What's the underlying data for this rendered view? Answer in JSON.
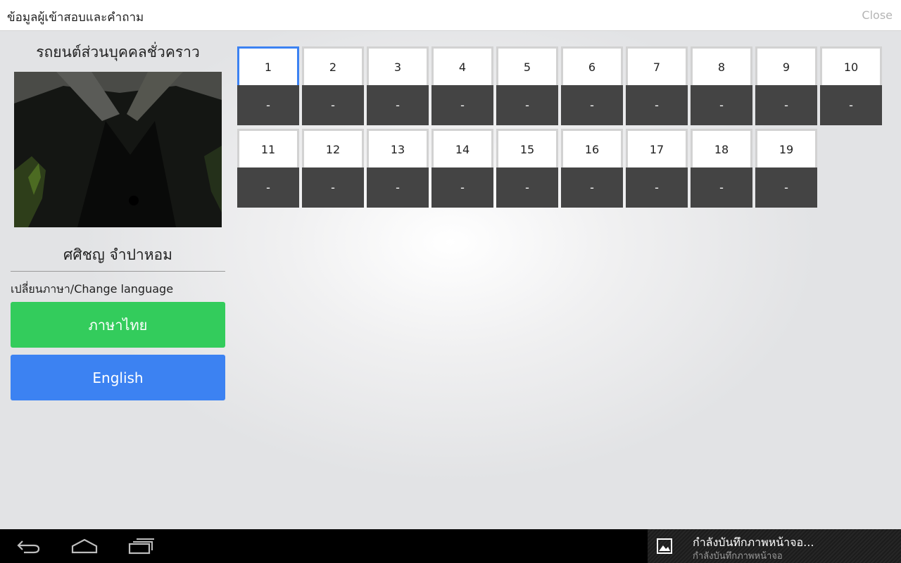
{
  "header": {
    "title": "ข้อมูลผู้เข้าสอบและคำถาม",
    "close_label": "Close"
  },
  "sidebar": {
    "vehicle_type": "รถยนต์ส่วนบุคคลชั่วคราว",
    "examinee_name": "ศศิชญ จำปาหอม",
    "language_label": "เปลี่ยนภาษา/Change language",
    "thai_button": "ภาษาไทย",
    "english_button": "English"
  },
  "questions": [
    {
      "number": "1",
      "answer": "-",
      "active": true
    },
    {
      "number": "2",
      "answer": "-"
    },
    {
      "number": "3",
      "answer": "-"
    },
    {
      "number": "4",
      "answer": "-"
    },
    {
      "number": "5",
      "answer": "-"
    },
    {
      "number": "6",
      "answer": "-"
    },
    {
      "number": "7",
      "answer": "-"
    },
    {
      "number": "8",
      "answer": "-"
    },
    {
      "number": "9",
      "answer": "-"
    },
    {
      "number": "10",
      "answer": "-"
    },
    {
      "number": "11",
      "answer": "-"
    },
    {
      "number": "12",
      "answer": "-"
    },
    {
      "number": "13",
      "answer": "-"
    },
    {
      "number": "14",
      "answer": "-"
    },
    {
      "number": "15",
      "answer": "-"
    },
    {
      "number": "16",
      "answer": "-"
    },
    {
      "number": "17",
      "answer": "-"
    },
    {
      "number": "18",
      "answer": "-"
    },
    {
      "number": "19",
      "answer": "-"
    }
  ],
  "navbar": {
    "icons": [
      "back-icon",
      "home-icon",
      "recent-apps-icon"
    ]
  },
  "notification": {
    "icon": "image-icon",
    "title": "กำลังบันทึกภาพหน้าจอ...",
    "subtitle": "กำลังบันทึกภาพหน้าจอ"
  },
  "colors": {
    "thai_button": "#33cc5c",
    "english_button": "#3c82f2",
    "answer_cell": "#444444",
    "active_border": "#3c82f2"
  }
}
